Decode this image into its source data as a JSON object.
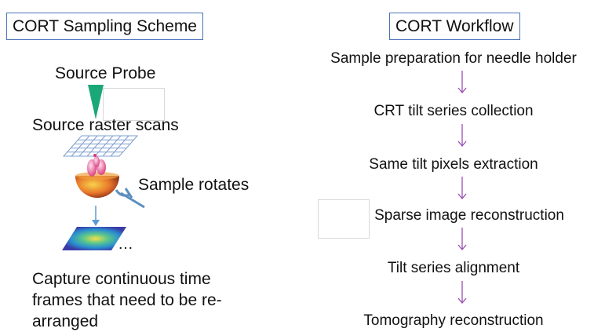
{
  "left": {
    "title": "CORT Sampling Scheme",
    "source_probe": "Source Probe",
    "source_raster": "Source raster scans",
    "sample_rotates": "Sample rotates",
    "ellipsis": "…",
    "caption_lines": [
      "Capture continuous time",
      "frames that need to be re-",
      "arranged"
    ]
  },
  "right": {
    "title": "CORT Workflow",
    "steps": [
      "Sample preparation for needle holder",
      "CRT tilt series collection",
      "Same tilt pixels extraction",
      "Sparse image reconstruction",
      "Tilt series alignment",
      "Tomography reconstruction"
    ]
  },
  "colors": {
    "title_border": "#4a73b8",
    "probe": "#1aa877",
    "grid": "#7f9fd0",
    "workflow_arrow": "#9a4fb3",
    "sample_arrow": "#5b9bd5"
  }
}
